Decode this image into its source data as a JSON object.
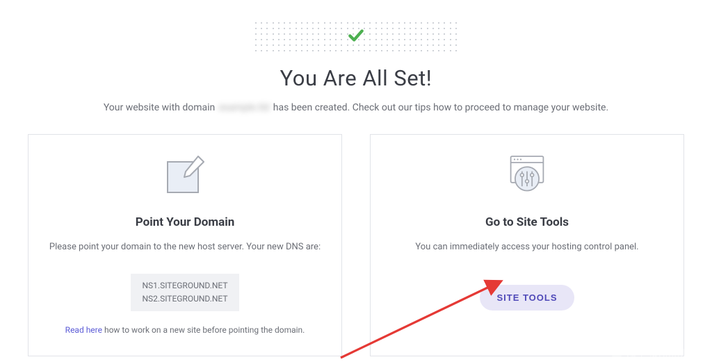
{
  "heading": "You Are All Set!",
  "subheading": {
    "prefix": "Your website with domain",
    "domain_placeholder": "example.tld",
    "suffix": "has been created. Check out our tips how to proceed to manage your website."
  },
  "cards": {
    "left": {
      "title": "Point Your Domain",
      "desc": "Please point your domain to the new host server. Your new DNS are:",
      "dns1": "NS1.SITEGROUND.NET",
      "dns2": "NS2.SITEGROUND.NET",
      "read_here": "Read here",
      "read_here_tail": " how to work on a new site before pointing the domain."
    },
    "right": {
      "title": "Go to Site Tools",
      "desc": "You can immediately access your hosting control panel.",
      "button": "SITE TOOLS"
    }
  },
  "watermark": "知乎 @Xmmblog"
}
